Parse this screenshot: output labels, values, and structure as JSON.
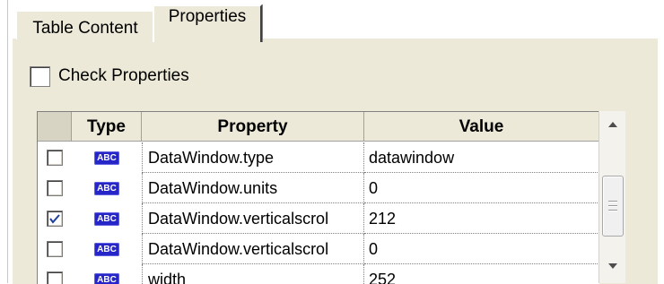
{
  "tabs": [
    {
      "label": "Table Content",
      "active": false
    },
    {
      "label": "Properties",
      "active": true
    }
  ],
  "check_properties": {
    "label": "Check Properties",
    "checked": false
  },
  "grid": {
    "columns": {
      "select": "",
      "type": "Type",
      "property": "Property",
      "value": "Value"
    },
    "rows": [
      {
        "checked": false,
        "type_icon": "abc-string-icon",
        "type_text": "ABC",
        "property": "DataWindow.type",
        "value": "datawindow"
      },
      {
        "checked": false,
        "type_icon": "abc-string-icon",
        "type_text": "ABC",
        "property": "DataWindow.units",
        "value": "0"
      },
      {
        "checked": true,
        "type_icon": "abc-string-icon",
        "type_text": "ABC",
        "property": "DataWindow.verticalscrol",
        "value": "212"
      },
      {
        "checked": false,
        "type_icon": "abc-string-icon",
        "type_text": "ABC",
        "property": "DataWindow.verticalscrol",
        "value": "0"
      },
      {
        "checked": false,
        "type_icon": "abc-string-icon",
        "type_text": "ABC",
        "property": "width",
        "value": "252"
      }
    ]
  },
  "scrollbar": {
    "up_icon": "arrow-up-icon",
    "down_icon": "arrow-down-icon"
  },
  "colors": {
    "panel": "#ece9d8",
    "abc_badge": "#2525c8",
    "check": "#1f3f9f"
  }
}
